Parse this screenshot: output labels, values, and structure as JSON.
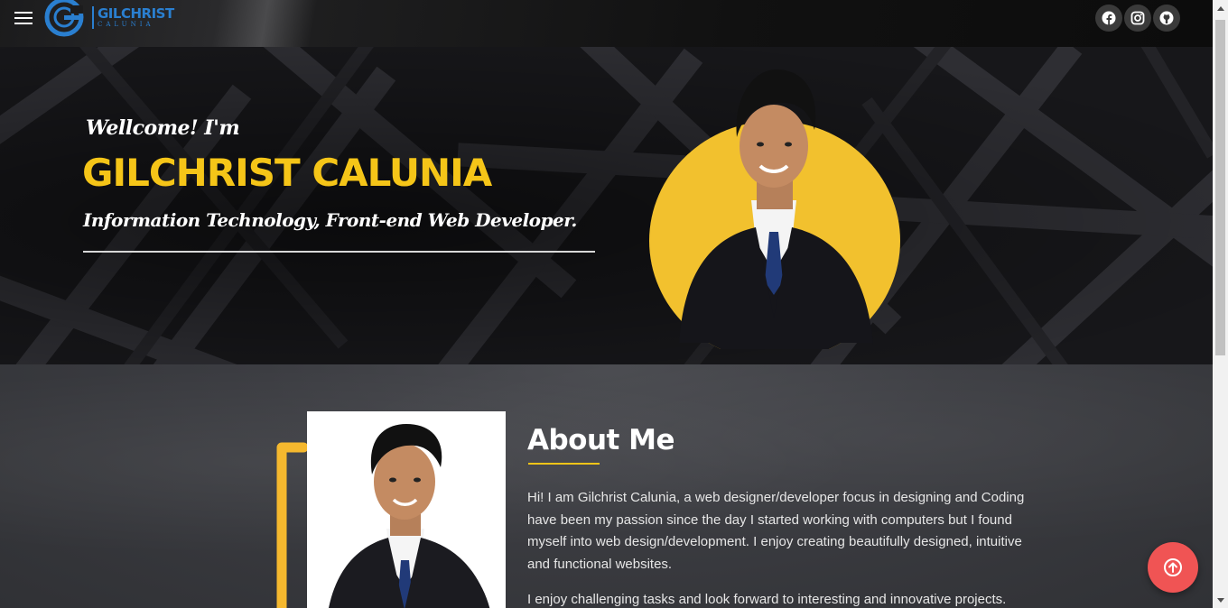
{
  "header": {
    "menu_icon": "hamburger-menu-icon",
    "logo": {
      "name": "GILCHRIST",
      "sub": "CALUNIA",
      "color": "#2a7fd0"
    },
    "socials": [
      {
        "name": "facebook",
        "icon": "facebook-icon"
      },
      {
        "name": "instagram",
        "icon": "instagram-icon"
      },
      {
        "name": "github",
        "icon": "github-icon"
      }
    ]
  },
  "hero": {
    "welcome": "Wellcome! I'm",
    "name": "GILCHRIST CALUNIA",
    "role": "Information Technology, Front-end Web Developer.",
    "accent": "#f5c518"
  },
  "about": {
    "title": "About Me",
    "paragraph1": "Hi!  I am Gilchrist Calunia, a web designer/developer focus in designing and Coding have been my passion since the day  I started working with computers but  I found myself into web design/development.  I enjoy creating beautifully designed, intuitive and functional websites.",
    "paragraph2": "I enjoy challenging tasks and look forward to interesting and innovative projects.",
    "underline_color": "#f5c518"
  },
  "back_to_top": {
    "icon": "arrow-up-circle-icon",
    "color": "#f05454"
  }
}
